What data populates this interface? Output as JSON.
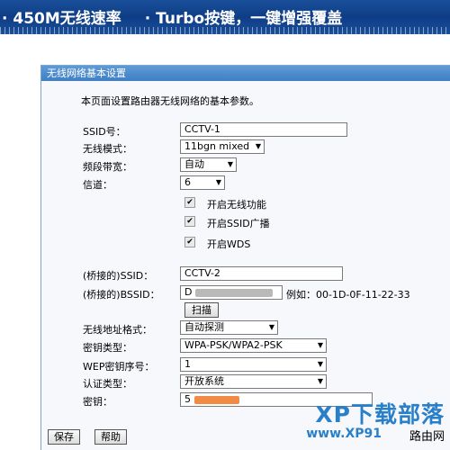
{
  "banner": {
    "part1": "· 450M无线速率",
    "part2": "· Turbo按键，一键增强覆盖"
  },
  "panel": {
    "title": "无线网络基本设置",
    "description": "本页面设置路由器无线网络的基本参数。"
  },
  "form": {
    "ssid_label": "SSID号：",
    "ssid_value": "CCTV-1",
    "mode_label": "无线模式：",
    "mode_value": "11bgn mixed",
    "bandwidth_label": "频段带宽：",
    "bandwidth_value": "自动",
    "channel_label": "信道：",
    "channel_value": "6",
    "enable_wireless_label": "开启无线功能",
    "enable_ssid_broadcast_label": "开启SSID广播",
    "enable_wds_label": "开启WDS",
    "bridged_ssid_label": "(桥接的)SSID：",
    "bridged_ssid_value": "CCTV-2",
    "bridged_bssid_label": "(桥接的)BSSID：",
    "bridged_bssid_value": "D",
    "bssid_example": "例如：00-1D-0F-11-22-33",
    "scan_label": "扫描",
    "addr_format_label": "无线地址格式：",
    "addr_format_value": "自动探测",
    "key_type_label": "密钥类型：",
    "key_type_value": "WPA-PSK/WPA2-PSK",
    "wep_index_label": "WEP密钥序号：",
    "wep_index_value": "1",
    "auth_type_label": "认证类型：",
    "auth_type_value": "开放系统",
    "key_label": "密钥：",
    "key_value": "5"
  },
  "buttons": {
    "save": "保存",
    "help": "帮助"
  },
  "watermark": {
    "line1": "XP下载部落",
    "line2": "www.XP91",
    "line3": "路由网"
  },
  "icons": {
    "check": "checkmark-icon",
    "dropdown": "down-triangle-icon"
  }
}
